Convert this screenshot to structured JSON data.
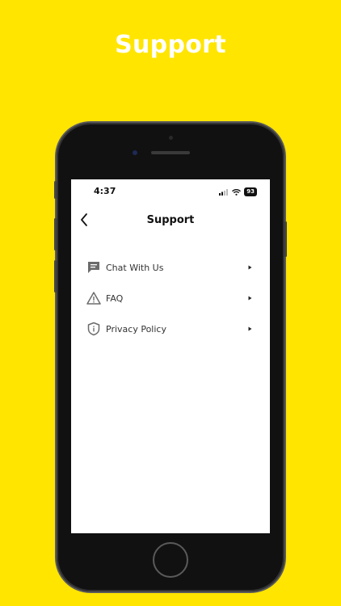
{
  "promo": {
    "title": "Support"
  },
  "status_bar": {
    "time": "4:37",
    "battery": "93"
  },
  "nav": {
    "title": "Support",
    "back_icon": "chevron-left-icon"
  },
  "menu": {
    "items": [
      {
        "label": "Chat With Us",
        "icon": "chat-bubble-icon"
      },
      {
        "label": "FAQ",
        "icon": "warning-triangle-icon"
      },
      {
        "label": "Privacy Policy",
        "icon": "shield-info-icon"
      }
    ]
  },
  "colors": {
    "background": "#FFE500",
    "icon": "#6b6b6b",
    "text": "#333333"
  }
}
